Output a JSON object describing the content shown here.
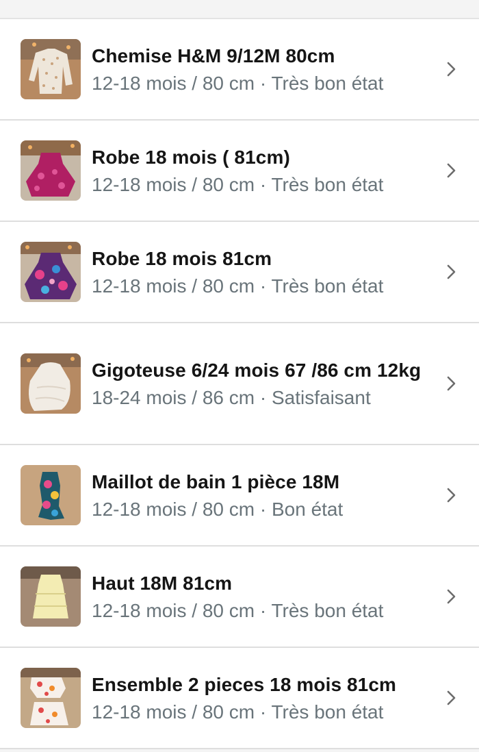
{
  "items": [
    {
      "title": "Chemise H&M 9/12M 80cm",
      "subtitle": "12-18 mois / 80 cm · Très bon état",
      "thumb_icon": "shirt-photo"
    },
    {
      "title": "Robe 18 mois ( 81cm)",
      "subtitle": "12-18 mois / 80 cm · Très bon état",
      "thumb_icon": "dress-photo"
    },
    {
      "title": "Robe 18 mois 81cm",
      "subtitle": "12-18 mois / 80 cm · Très bon état",
      "thumb_icon": "dress-photo"
    },
    {
      "title": "Gigoteuse 6/24 mois 67 /86 cm 12kg",
      "subtitle": "18-24 mois / 86 cm · Satisfaisant",
      "thumb_icon": "sleeping-bag-photo"
    },
    {
      "title": "Maillot de bain 1 pièce 18M",
      "subtitle": "12-18 mois / 80 cm · Bon état",
      "thumb_icon": "swimsuit-photo"
    },
    {
      "title": "Haut 18M 81cm",
      "subtitle": "12-18 mois / 80 cm · Très bon état",
      "thumb_icon": "top-photo"
    },
    {
      "title": "Ensemble 2 pieces 18 mois 81cm",
      "subtitle": "12-18 mois / 80 cm · Très bon état",
      "thumb_icon": "outfit-photo"
    }
  ],
  "chevron_icon": "chevron-right-icon",
  "colors": {
    "title": "#151515",
    "subtitle": "#69747a",
    "divider": "#dedede",
    "background": "#ffffff"
  }
}
